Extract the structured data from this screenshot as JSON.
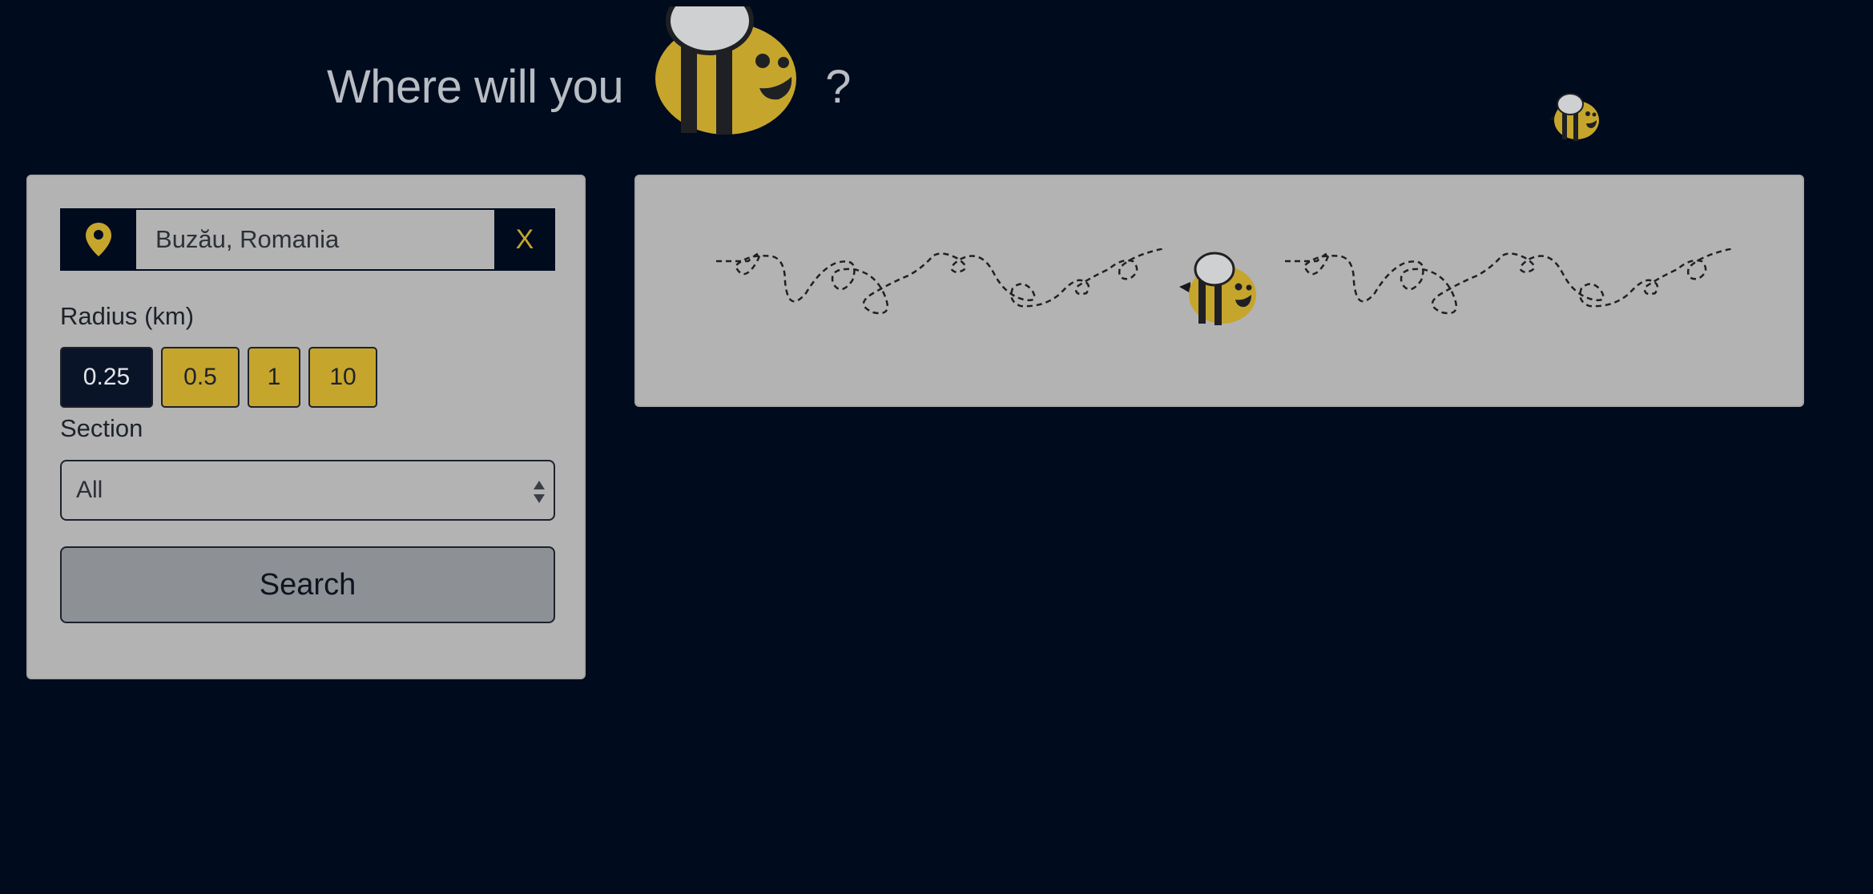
{
  "header": {
    "title_text": "Where will you",
    "title_suffix": "?",
    "title_icon": "bee-icon"
  },
  "search_form": {
    "location": {
      "icon": "map-pin-icon",
      "value": "Buzău, Romania",
      "clear_label": "X"
    },
    "radius": {
      "label": "Radius (km)",
      "options": [
        "0.25",
        "0.5",
        "1",
        "10"
      ],
      "selected": "0.25"
    },
    "section": {
      "label": "Section",
      "selected_value": "All"
    },
    "search_label": "Search"
  },
  "loading": {
    "icon": "bee-icon",
    "trail": "dashed-flight-path"
  },
  "colors": {
    "background": "#000b1e",
    "panel": "#b3b3b3",
    "accent_yellow": "#c6a52c",
    "active_button": "#0a1428",
    "search_button": "#8d9196",
    "header_text": "#b8bdc4"
  }
}
